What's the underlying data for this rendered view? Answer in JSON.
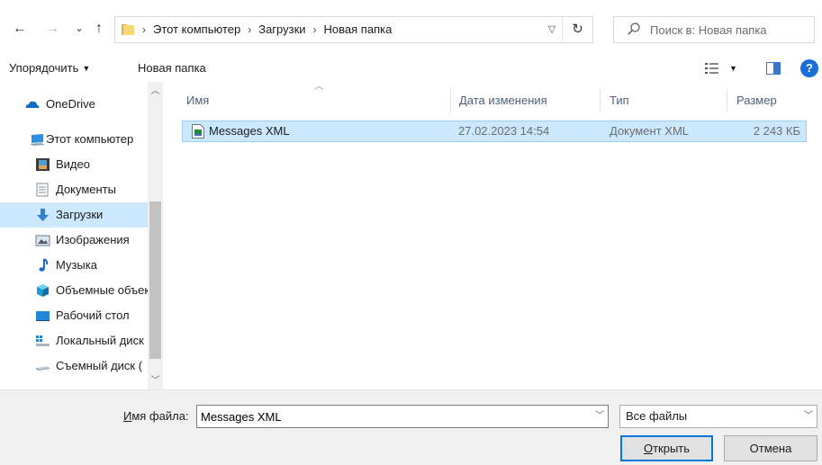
{
  "address_bar": {
    "crumbs": [
      "Этот компьютер",
      "Загрузки",
      "Новая папка"
    ],
    "search_placeholder": "Поиск в: Новая папка"
  },
  "toolbar": {
    "organize_label": "Упорядочить",
    "new_folder_label": "Новая папка"
  },
  "nav": {
    "items": [
      {
        "label": "OneDrive",
        "icon": "onedrive-cloud-icon"
      },
      {
        "label": "Этот компьютер",
        "icon": "computer-icon"
      },
      {
        "label": "Видео",
        "icon": "video-folder-icon"
      },
      {
        "label": "Документы",
        "icon": "documents-folder-icon"
      },
      {
        "label": "Загрузки",
        "icon": "downloads-folder-icon",
        "selected": true
      },
      {
        "label": "Изображения",
        "icon": "pictures-folder-icon"
      },
      {
        "label": "Музыка",
        "icon": "music-folder-icon"
      },
      {
        "label": "Объемные объекты",
        "icon": "3d-objects-folder-icon"
      },
      {
        "label": "Рабочий стол",
        "icon": "desktop-folder-icon"
      },
      {
        "label": "Локальный диск (C:)",
        "icon": "local-disk-icon"
      },
      {
        "label": "Съемный диск (",
        "icon": "removable-disk-icon"
      }
    ]
  },
  "file_list": {
    "columns": [
      "Имя",
      "Дата изменения",
      "Тип",
      "Размер"
    ],
    "rows": [
      {
        "name": "Messages XML",
        "date": "27.02.2023 14:54",
        "type": "Документ XML",
        "size": "2 243 КБ",
        "selected": true
      }
    ]
  },
  "bottom": {
    "filename_label_u": "И",
    "filename_label_rest": "мя файла:",
    "filename_value": "Messages XML",
    "filetype_value": "Все файлы",
    "open_label_u": "О",
    "open_label_rest": "ткрыть",
    "cancel_label": "Отмена"
  },
  "colors": {
    "selection": "#cce8ff",
    "selection_border": "#99d1ff",
    "accent": "#0078d7",
    "help": "#1a6fd6"
  }
}
